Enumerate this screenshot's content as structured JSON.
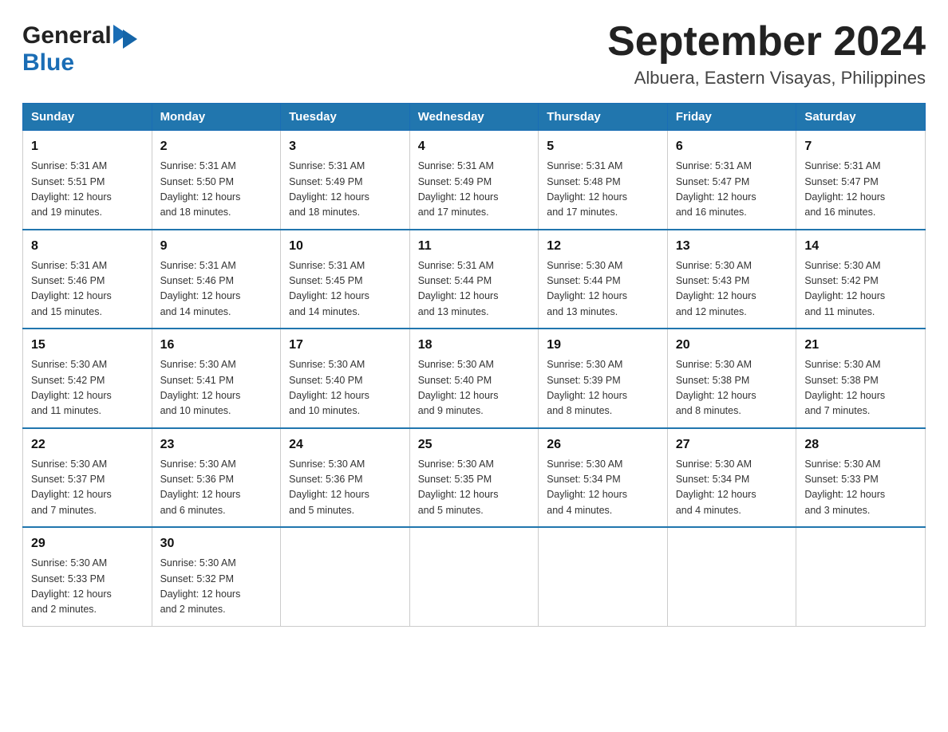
{
  "logo": {
    "general": "General",
    "blue": "Blue"
  },
  "title": "September 2024",
  "subtitle": "Albuera, Eastern Visayas, Philippines",
  "weekdays": [
    "Sunday",
    "Monday",
    "Tuesday",
    "Wednesday",
    "Thursday",
    "Friday",
    "Saturday"
  ],
  "weeks": [
    [
      {
        "num": "1",
        "info": "Sunrise: 5:31 AM\nSunset: 5:51 PM\nDaylight: 12 hours\nand 19 minutes."
      },
      {
        "num": "2",
        "info": "Sunrise: 5:31 AM\nSunset: 5:50 PM\nDaylight: 12 hours\nand 18 minutes."
      },
      {
        "num": "3",
        "info": "Sunrise: 5:31 AM\nSunset: 5:49 PM\nDaylight: 12 hours\nand 18 minutes."
      },
      {
        "num": "4",
        "info": "Sunrise: 5:31 AM\nSunset: 5:49 PM\nDaylight: 12 hours\nand 17 minutes."
      },
      {
        "num": "5",
        "info": "Sunrise: 5:31 AM\nSunset: 5:48 PM\nDaylight: 12 hours\nand 17 minutes."
      },
      {
        "num": "6",
        "info": "Sunrise: 5:31 AM\nSunset: 5:47 PM\nDaylight: 12 hours\nand 16 minutes."
      },
      {
        "num": "7",
        "info": "Sunrise: 5:31 AM\nSunset: 5:47 PM\nDaylight: 12 hours\nand 16 minutes."
      }
    ],
    [
      {
        "num": "8",
        "info": "Sunrise: 5:31 AM\nSunset: 5:46 PM\nDaylight: 12 hours\nand 15 minutes."
      },
      {
        "num": "9",
        "info": "Sunrise: 5:31 AM\nSunset: 5:46 PM\nDaylight: 12 hours\nand 14 minutes."
      },
      {
        "num": "10",
        "info": "Sunrise: 5:31 AM\nSunset: 5:45 PM\nDaylight: 12 hours\nand 14 minutes."
      },
      {
        "num": "11",
        "info": "Sunrise: 5:31 AM\nSunset: 5:44 PM\nDaylight: 12 hours\nand 13 minutes."
      },
      {
        "num": "12",
        "info": "Sunrise: 5:30 AM\nSunset: 5:44 PM\nDaylight: 12 hours\nand 13 minutes."
      },
      {
        "num": "13",
        "info": "Sunrise: 5:30 AM\nSunset: 5:43 PM\nDaylight: 12 hours\nand 12 minutes."
      },
      {
        "num": "14",
        "info": "Sunrise: 5:30 AM\nSunset: 5:42 PM\nDaylight: 12 hours\nand 11 minutes."
      }
    ],
    [
      {
        "num": "15",
        "info": "Sunrise: 5:30 AM\nSunset: 5:42 PM\nDaylight: 12 hours\nand 11 minutes."
      },
      {
        "num": "16",
        "info": "Sunrise: 5:30 AM\nSunset: 5:41 PM\nDaylight: 12 hours\nand 10 minutes."
      },
      {
        "num": "17",
        "info": "Sunrise: 5:30 AM\nSunset: 5:40 PM\nDaylight: 12 hours\nand 10 minutes."
      },
      {
        "num": "18",
        "info": "Sunrise: 5:30 AM\nSunset: 5:40 PM\nDaylight: 12 hours\nand 9 minutes."
      },
      {
        "num": "19",
        "info": "Sunrise: 5:30 AM\nSunset: 5:39 PM\nDaylight: 12 hours\nand 8 minutes."
      },
      {
        "num": "20",
        "info": "Sunrise: 5:30 AM\nSunset: 5:38 PM\nDaylight: 12 hours\nand 8 minutes."
      },
      {
        "num": "21",
        "info": "Sunrise: 5:30 AM\nSunset: 5:38 PM\nDaylight: 12 hours\nand 7 minutes."
      }
    ],
    [
      {
        "num": "22",
        "info": "Sunrise: 5:30 AM\nSunset: 5:37 PM\nDaylight: 12 hours\nand 7 minutes."
      },
      {
        "num": "23",
        "info": "Sunrise: 5:30 AM\nSunset: 5:36 PM\nDaylight: 12 hours\nand 6 minutes."
      },
      {
        "num": "24",
        "info": "Sunrise: 5:30 AM\nSunset: 5:36 PM\nDaylight: 12 hours\nand 5 minutes."
      },
      {
        "num": "25",
        "info": "Sunrise: 5:30 AM\nSunset: 5:35 PM\nDaylight: 12 hours\nand 5 minutes."
      },
      {
        "num": "26",
        "info": "Sunrise: 5:30 AM\nSunset: 5:34 PM\nDaylight: 12 hours\nand 4 minutes."
      },
      {
        "num": "27",
        "info": "Sunrise: 5:30 AM\nSunset: 5:34 PM\nDaylight: 12 hours\nand 4 minutes."
      },
      {
        "num": "28",
        "info": "Sunrise: 5:30 AM\nSunset: 5:33 PM\nDaylight: 12 hours\nand 3 minutes."
      }
    ],
    [
      {
        "num": "29",
        "info": "Sunrise: 5:30 AM\nSunset: 5:33 PM\nDaylight: 12 hours\nand 2 minutes."
      },
      {
        "num": "30",
        "info": "Sunrise: 5:30 AM\nSunset: 5:32 PM\nDaylight: 12 hours\nand 2 minutes."
      },
      {
        "num": "",
        "info": ""
      },
      {
        "num": "",
        "info": ""
      },
      {
        "num": "",
        "info": ""
      },
      {
        "num": "",
        "info": ""
      },
      {
        "num": "",
        "info": ""
      }
    ]
  ]
}
